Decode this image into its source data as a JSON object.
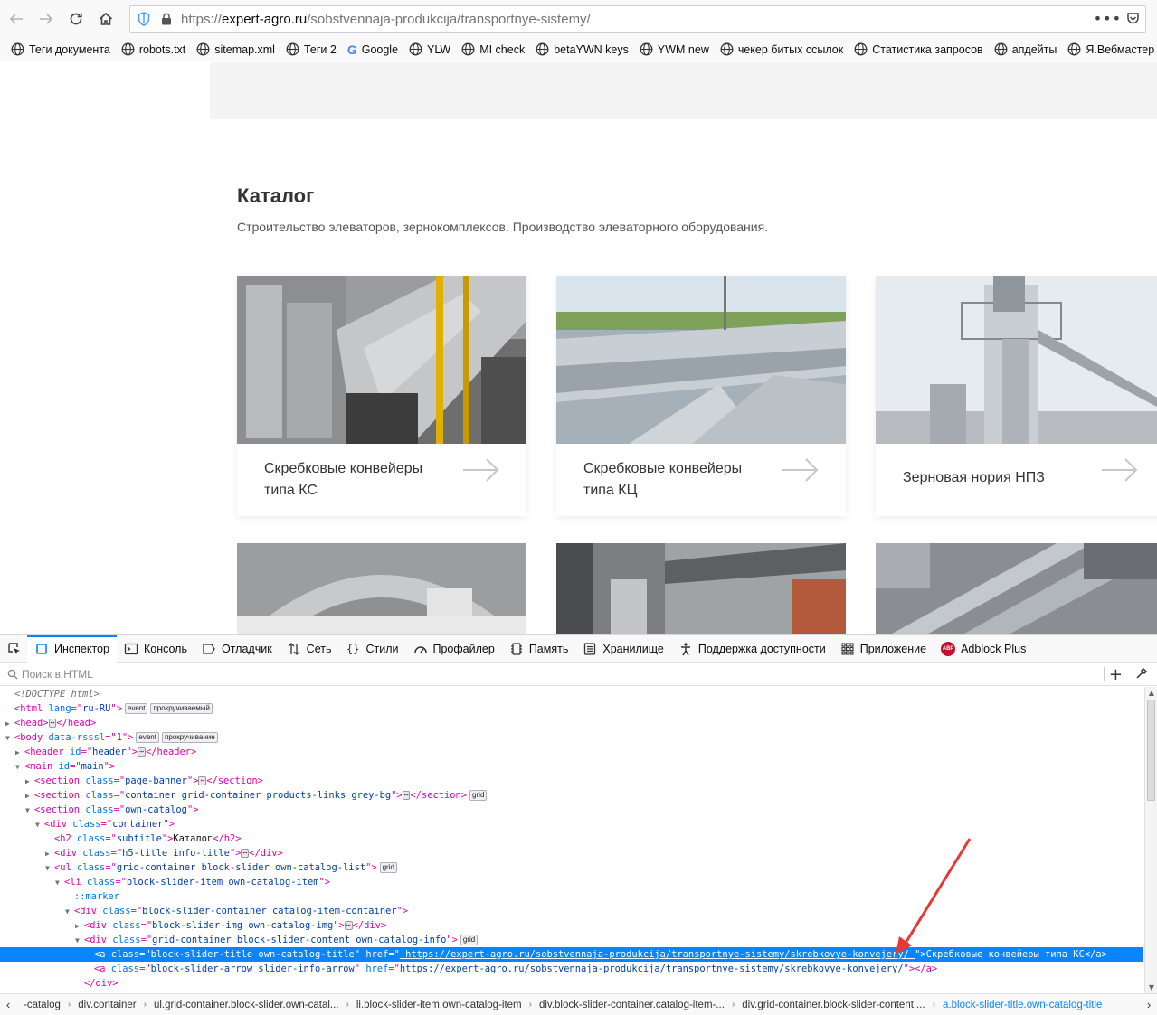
{
  "browser": {
    "url_prefix": "https://",
    "url_host": "expert-agro.ru",
    "url_path": "/sobstvennaja-produkcija/transportnye-sistemy/",
    "more_label": "•••",
    "bookmarks": [
      {
        "label": "Теги документа",
        "icon": "globe-icon"
      },
      {
        "label": "robots.txt",
        "icon": "globe-icon"
      },
      {
        "label": "sitemap.xml",
        "icon": "globe-icon"
      },
      {
        "label": "Теги 2",
        "icon": "globe-icon"
      },
      {
        "label": "Google",
        "icon": "google-icon"
      },
      {
        "label": "YLW",
        "icon": "globe-icon"
      },
      {
        "label": "MI check",
        "icon": "globe-icon"
      },
      {
        "label": "betaYWN keys",
        "icon": "globe-icon"
      },
      {
        "label": "YWM new",
        "icon": "globe-icon"
      },
      {
        "label": "чекер битых ссылок",
        "icon": "globe-icon"
      },
      {
        "label": "Статистика запросов",
        "icon": "globe-icon"
      },
      {
        "label": "апдейты",
        "icon": "globe-icon"
      },
      {
        "label": "Я.Вебмастер - страни",
        "icon": "globe-icon"
      }
    ]
  },
  "page": {
    "catalog_title": "Каталог",
    "catalog_subtitle": "Строительство элеваторов, зернокомплексов. Производство элеваторного оборудования.",
    "cards": [
      {
        "title": "Скребковые конвейеры типа КС"
      },
      {
        "title": "Скребковые конвейеры типа КЦ"
      },
      {
        "title": "Зерновая нория НПЗ"
      }
    ]
  },
  "devtools": {
    "tabs": [
      {
        "label": "Инспектор",
        "icon": "inspector-icon",
        "active": true
      },
      {
        "label": "Консоль",
        "icon": "console-icon"
      },
      {
        "label": "Отладчик",
        "icon": "debugger-icon"
      },
      {
        "label": "Сеть",
        "icon": "network-icon"
      },
      {
        "label": "Стили",
        "icon": "styles-icon"
      },
      {
        "label": "Профайлер",
        "icon": "profiler-icon"
      },
      {
        "label": "Память",
        "icon": "memory-icon"
      },
      {
        "label": "Хранилище",
        "icon": "storage-icon"
      },
      {
        "label": "Поддержка доступности",
        "icon": "accessibility-icon"
      },
      {
        "label": "Приложение",
        "icon": "application-icon"
      },
      {
        "label": "Adblock Plus",
        "icon": "adblock-icon"
      }
    ],
    "search_placeholder": "Поиск в HTML",
    "plus_label": "+",
    "tree": [
      {
        "indent": 0,
        "tw": "",
        "parts": [
          [
            "cmt",
            "<!DOCTYPE html>"
          ]
        ]
      },
      {
        "indent": 0,
        "tw": "",
        "parts": [
          [
            "tag",
            "<html "
          ],
          [
            "attr",
            "lang"
          ],
          [
            "tag",
            "=\""
          ],
          [
            "val",
            "ru-RU"
          ],
          [
            "tag",
            "\">"
          ]
        ],
        "badges": [
          "event",
          "прокручиваемый"
        ]
      },
      {
        "indent": 0,
        "tw": "▶",
        "parts": [
          [
            "tag",
            "<head>"
          ],
          [
            "dots",
            "⋯"
          ],
          [
            "tag",
            "</head>"
          ]
        ]
      },
      {
        "indent": 0,
        "tw": "▼",
        "parts": [
          [
            "tag",
            "<body "
          ],
          [
            "attr",
            "data-rsssl"
          ],
          [
            "tag",
            "=\""
          ],
          [
            "val",
            "1"
          ],
          [
            "tag",
            "\">"
          ]
        ],
        "badges": [
          "event",
          "прокручивание"
        ]
      },
      {
        "indent": 1,
        "tw": "▶",
        "parts": [
          [
            "tag",
            "<header "
          ],
          [
            "attr",
            "id"
          ],
          [
            "tag",
            "=\""
          ],
          [
            "val",
            "header"
          ],
          [
            "tag",
            "\">"
          ],
          [
            "dots",
            "⋯"
          ],
          [
            "tag",
            "</header>"
          ]
        ]
      },
      {
        "indent": 1,
        "tw": "▼",
        "parts": [
          [
            "tag",
            "<main "
          ],
          [
            "attr",
            "id"
          ],
          [
            "tag",
            "=\""
          ],
          [
            "val",
            "main"
          ],
          [
            "tag",
            "\">"
          ]
        ]
      },
      {
        "indent": 2,
        "tw": "▶",
        "parts": [
          [
            "tag",
            "<section "
          ],
          [
            "attr",
            "class"
          ],
          [
            "tag",
            "=\""
          ],
          [
            "val",
            "page-banner"
          ],
          [
            "tag",
            "\">"
          ],
          [
            "dots",
            "⋯"
          ],
          [
            "tag",
            "</section>"
          ]
        ]
      },
      {
        "indent": 2,
        "tw": "▶",
        "parts": [
          [
            "tag",
            "<section "
          ],
          [
            "attr",
            "class"
          ],
          [
            "tag",
            "=\""
          ],
          [
            "val",
            "container grid-container products-links grey-bg"
          ],
          [
            "tag",
            "\">"
          ],
          [
            "dots",
            "⋯"
          ],
          [
            "tag",
            "</section>"
          ]
        ],
        "badges": [
          "grid"
        ]
      },
      {
        "indent": 2,
        "tw": "▼",
        "parts": [
          [
            "tag",
            "<section "
          ],
          [
            "attr",
            "class"
          ],
          [
            "tag",
            "=\""
          ],
          [
            "val",
            "own-catalog"
          ],
          [
            "tag",
            "\">"
          ]
        ]
      },
      {
        "indent": 3,
        "tw": "▼",
        "parts": [
          [
            "tag",
            "<div "
          ],
          [
            "attr",
            "class"
          ],
          [
            "tag",
            "=\""
          ],
          [
            "val",
            "container"
          ],
          [
            "tag",
            "\">"
          ]
        ]
      },
      {
        "indent": 4,
        "tw": "",
        "parts": [
          [
            "tag",
            "<h2 "
          ],
          [
            "attr",
            "class"
          ],
          [
            "tag",
            "=\""
          ],
          [
            "val",
            "subtitle"
          ],
          [
            "tag",
            "\">"
          ],
          [
            "txt",
            "Каталог"
          ],
          [
            "tag",
            "</h2>"
          ]
        ]
      },
      {
        "indent": 4,
        "tw": "▶",
        "parts": [
          [
            "tag",
            "<div "
          ],
          [
            "attr",
            "class"
          ],
          [
            "tag",
            "=\""
          ],
          [
            "val",
            "h5-title info-title"
          ],
          [
            "tag",
            "\">"
          ],
          [
            "dots",
            "⋯"
          ],
          [
            "tag",
            "</div>"
          ]
        ]
      },
      {
        "indent": 4,
        "tw": "▼",
        "parts": [
          [
            "tag",
            "<ul "
          ],
          [
            "attr",
            "class"
          ],
          [
            "tag",
            "=\""
          ],
          [
            "val",
            "grid-container block-slider own-catalog-list"
          ],
          [
            "tag",
            "\">"
          ]
        ],
        "badges": [
          "grid"
        ]
      },
      {
        "indent": 5,
        "tw": "▼",
        "parts": [
          [
            "tag",
            "<li "
          ],
          [
            "attr",
            "class"
          ],
          [
            "tag",
            "=\""
          ],
          [
            "val",
            "block-slider-item own-catalog-item"
          ],
          [
            "tag",
            "\">"
          ]
        ]
      },
      {
        "indent": 6,
        "tw": "",
        "parts": [
          [
            "attr",
            "::marker"
          ]
        ]
      },
      {
        "indent": 6,
        "tw": "▼",
        "parts": [
          [
            "tag",
            "<div "
          ],
          [
            "attr",
            "class"
          ],
          [
            "tag",
            "=\""
          ],
          [
            "val",
            "block-slider-container catalog-item-container"
          ],
          [
            "tag",
            "\">"
          ]
        ]
      },
      {
        "indent": 7,
        "tw": "▶",
        "parts": [
          [
            "tag",
            "<div "
          ],
          [
            "attr",
            "class"
          ],
          [
            "tag",
            "=\""
          ],
          [
            "val",
            "block-slider-img own-catalog-img"
          ],
          [
            "tag",
            "\">"
          ],
          [
            "dots",
            "⋯"
          ],
          [
            "tag",
            "</div>"
          ]
        ]
      },
      {
        "indent": 7,
        "tw": "▼",
        "parts": [
          [
            "tag",
            "<div "
          ],
          [
            "attr",
            "class"
          ],
          [
            "tag",
            "=\""
          ],
          [
            "val",
            "grid-container block-slider-content own-catalog-info"
          ],
          [
            "tag",
            "\">"
          ]
        ],
        "badges": [
          "grid"
        ]
      },
      {
        "indent": 8,
        "tw": "",
        "sel": true,
        "parts": [
          [
            "tag",
            "<a "
          ],
          [
            "attr",
            "class"
          ],
          [
            "tag",
            "=\""
          ],
          [
            "val",
            "block-slider-title own-catalog-title"
          ],
          [
            "tag",
            "\" "
          ],
          [
            "attr",
            "href"
          ],
          [
            "tag",
            "=\""
          ],
          [
            "link",
            " https://expert-agro.ru/sobstvennaja-produkcija/transportnye-sistemy/skrebkovye-konvejery/ "
          ],
          [
            "tag",
            "\">"
          ],
          [
            "txt",
            "Скребковые конвейеры типа КС"
          ],
          [
            "tag",
            "</a>"
          ]
        ]
      },
      {
        "indent": 8,
        "tw": "",
        "parts": [
          [
            "tag",
            "<a "
          ],
          [
            "attr",
            "class"
          ],
          [
            "tag",
            "=\""
          ],
          [
            "val",
            "block-slider-arrow slider-info-arrow"
          ],
          [
            "tag",
            "\" "
          ],
          [
            "attr",
            "href"
          ],
          [
            "tag",
            "=\""
          ],
          [
            "link",
            "https://expert-agro.ru/sobstvennaja-produkcija/transportnye-sistemy/skrebkovye-konvejery/"
          ],
          [
            "tag",
            "\"></a>"
          ]
        ]
      },
      {
        "indent": 7,
        "tw": "",
        "parts": [
          [
            "tag",
            "</div>"
          ]
        ]
      },
      {
        "indent": 6,
        "tw": "",
        "parts": [
          [
            "tag",
            "</div>"
          ]
        ]
      }
    ],
    "breadcrumbs": [
      {
        "label": "-catalog"
      },
      {
        "label": "div.container"
      },
      {
        "label": "ul.grid-container.block-slider.own-catal..."
      },
      {
        "label": "li.block-slider-item.own-catalog-item"
      },
      {
        "label": "div.block-slider-container.catalog-item-..."
      },
      {
        "label": "div.grid-container.block-slider-content...."
      },
      {
        "label": "a.block-slider-title.own-catalog-title",
        "active": true
      }
    ]
  },
  "colors": {
    "accent": "#0a84ff",
    "selection": "#0a84ff",
    "annotation_arrow": "#e53935"
  }
}
